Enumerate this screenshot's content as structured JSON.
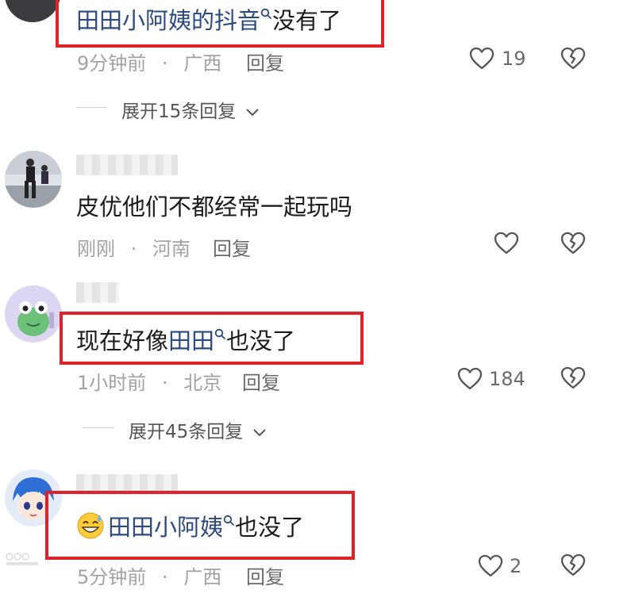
{
  "comments": [
    {
      "link_text": "田田小阿姨的抖音",
      "rest_text": "没有了",
      "time": "9分钟前",
      "location": "广西",
      "reply_label": "回复",
      "likes": "19",
      "expand": "展开15条回复"
    },
    {
      "text": "皮优他们不都经常一起玩吗",
      "time": "刚刚",
      "location": "河南",
      "reply_label": "回复"
    },
    {
      "pre_text": "现在好像",
      "link_text": "田田",
      "rest_text": "也没了",
      "time": "1小时前",
      "location": "北京",
      "reply_label": "回复",
      "likes": "184",
      "expand": "展开45条回复"
    },
    {
      "link_text": "田田小阿姨",
      "rest_text": "也没了",
      "time": "5分钟前",
      "location": "广西",
      "reply_label": "回复",
      "likes": "2"
    }
  ],
  "separator": "·",
  "colors": {
    "highlight_box": "#e0232b",
    "link": "#2a4a7e"
  },
  "icons": [
    "search-icon",
    "heart-icon",
    "broken-heart-icon",
    "chevron-down-icon",
    "grinning-sweat-emoji"
  ]
}
